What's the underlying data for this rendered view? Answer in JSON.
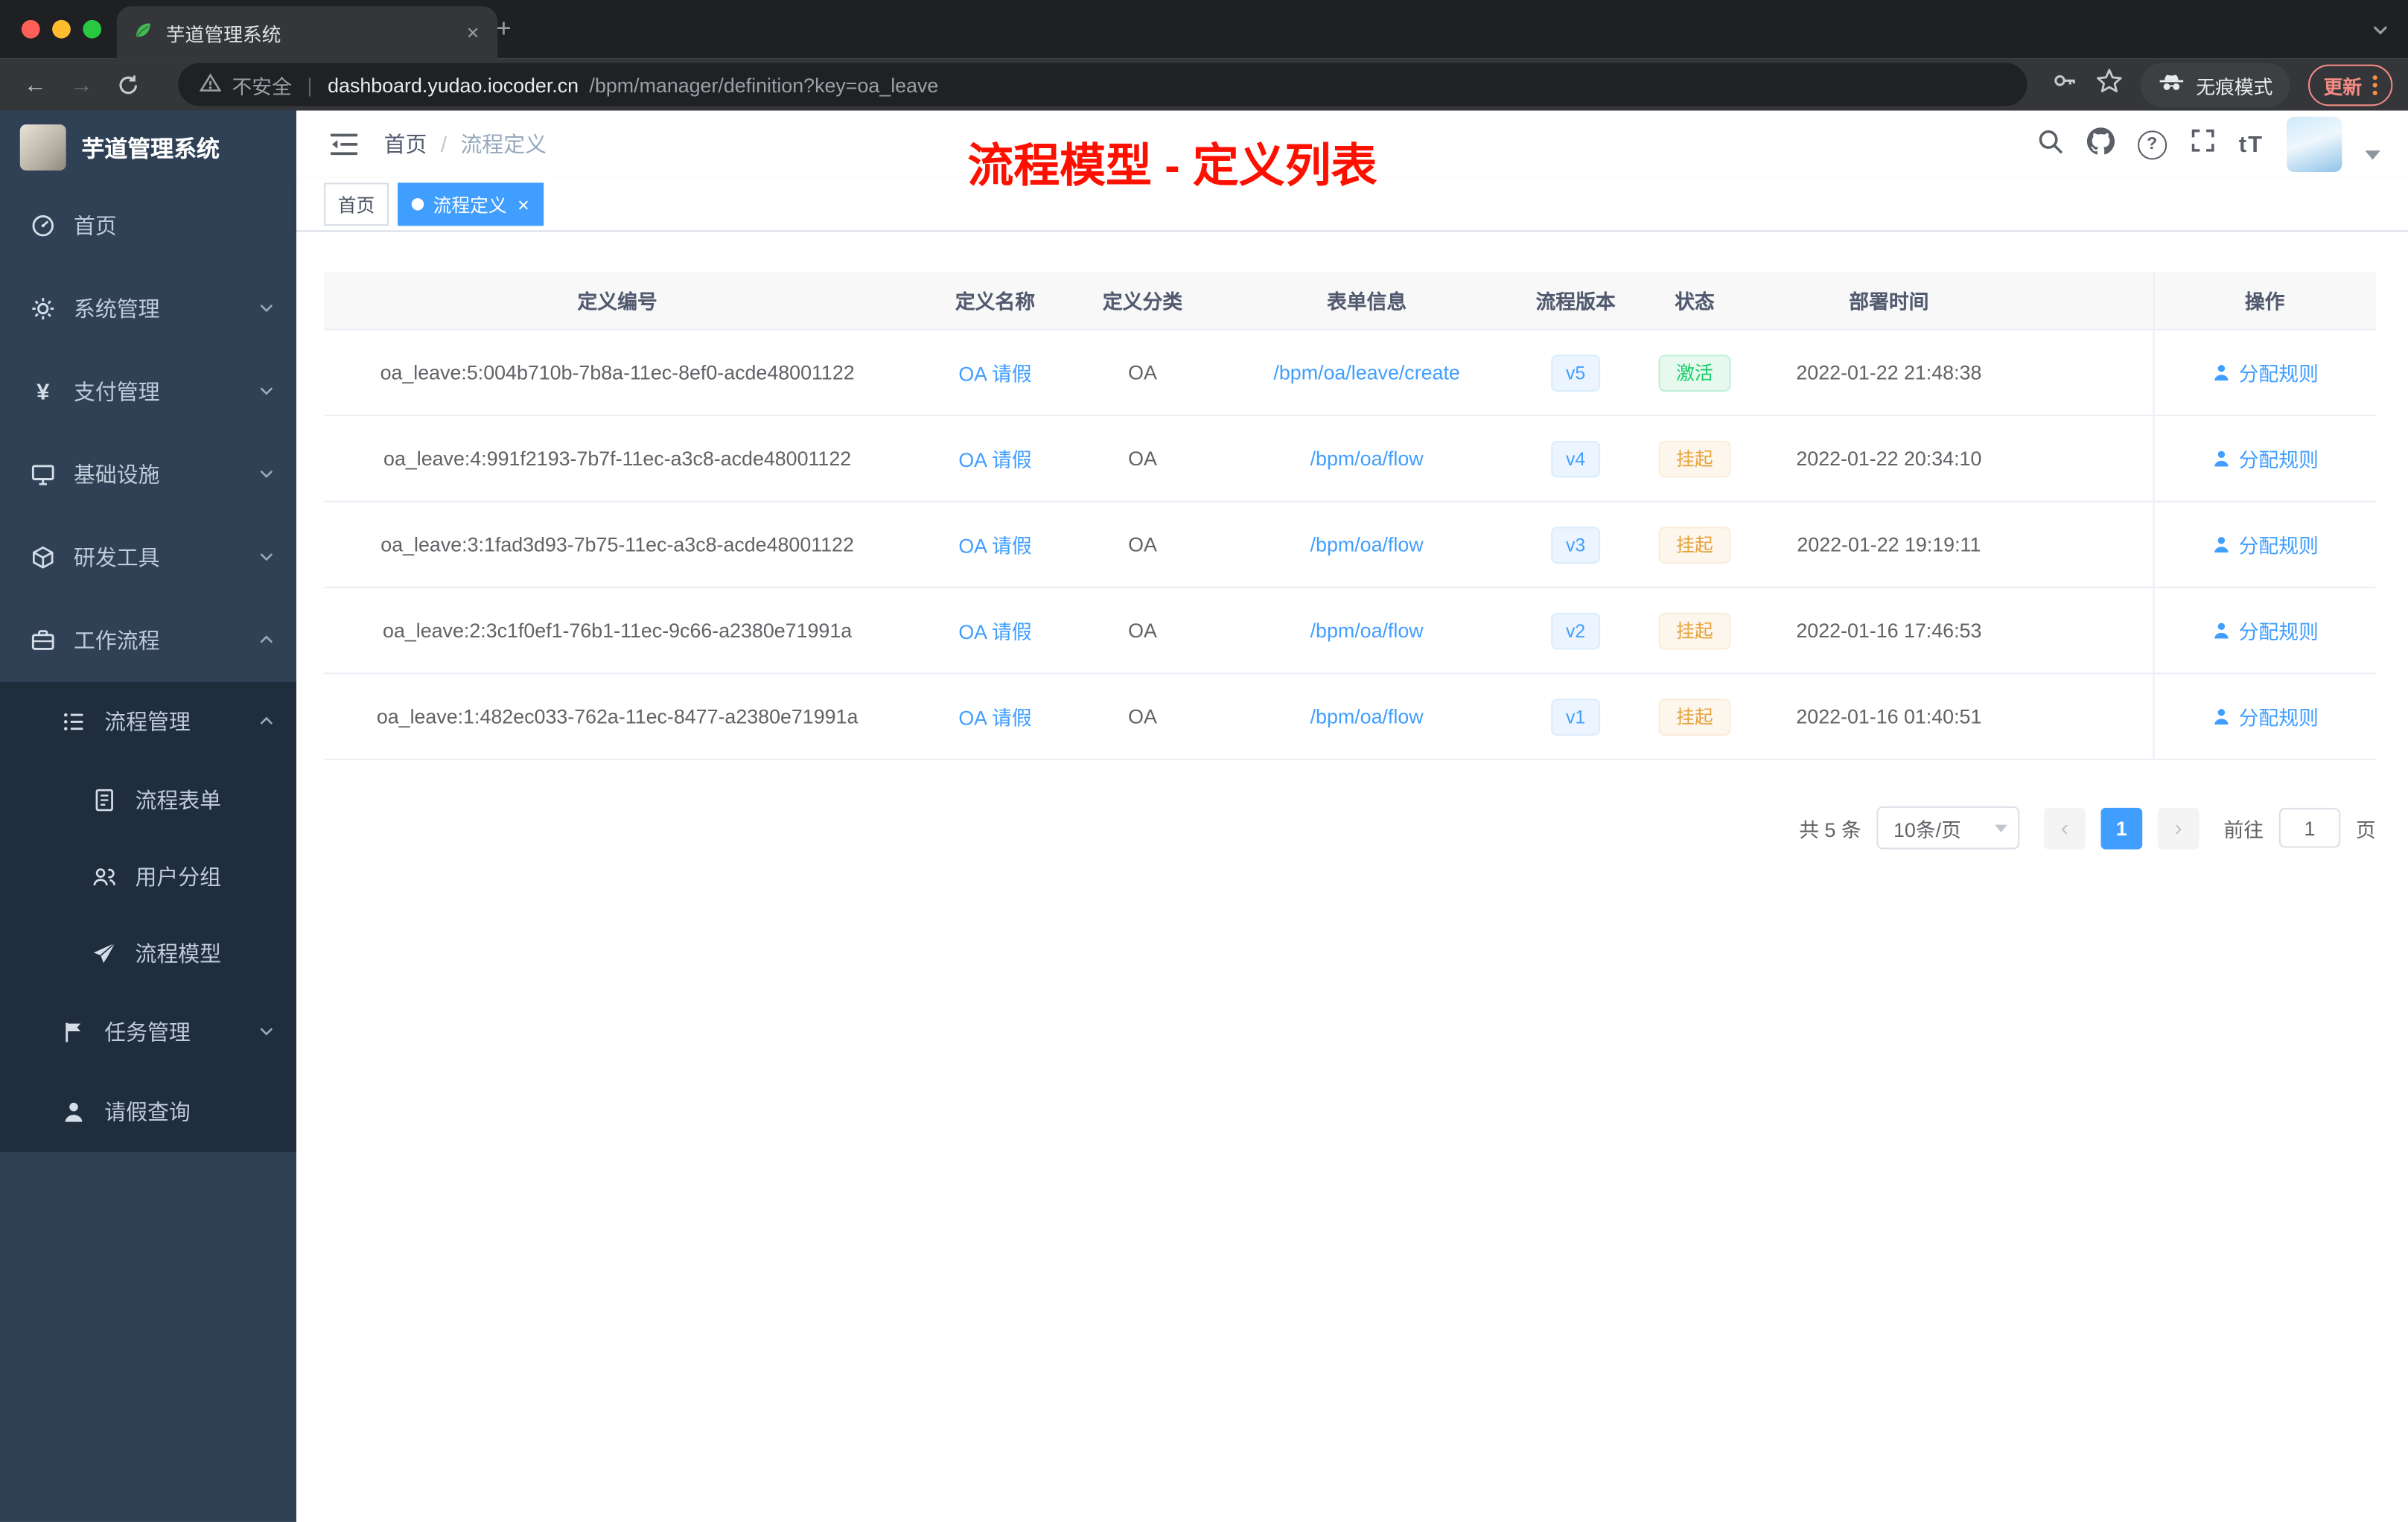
{
  "colors": {
    "accent_blue": "#409eff",
    "annotation_red": "#fe1000",
    "sidebar_bg": "#304156",
    "submenu_bg": "#1f2d3d",
    "success_green": "#13ce66",
    "warning_orange": "#e6a23c"
  },
  "icons": {
    "close": "×",
    "plus": "+",
    "back_arrow": "←",
    "forward_arrow": "→",
    "prev": "‹",
    "next": "›",
    "question": "?",
    "yen": "¥",
    "tab_caret": "⌄"
  },
  "browser": {
    "tab_title": "芋道管理系统",
    "address": {
      "security_label": "不安全",
      "separator": "|",
      "url_host": "dashboard.yudao.iocoder.cn",
      "url_path": "/bpm/manager/definition?key=oa_leave"
    },
    "incognito_label": "无痕模式",
    "update_button": "更新"
  },
  "sidebar": {
    "logo_title": "芋道管理系统",
    "items": [
      {
        "label": "首页"
      },
      {
        "label": "系统管理"
      },
      {
        "label": "支付管理"
      },
      {
        "label": "基础设施"
      },
      {
        "label": "研发工具"
      },
      {
        "label": "工作流程"
      },
      {
        "label": "流程管理"
      },
      {
        "label": "流程表单"
      },
      {
        "label": "用户分组"
      },
      {
        "label": "流程模型"
      },
      {
        "label": "任务管理"
      },
      {
        "label": "请假查询"
      }
    ]
  },
  "navbar": {
    "breadcrumb": {
      "home": "首页",
      "separator": "/",
      "current": "流程定义"
    },
    "annotation": "流程模型 - 定义列表",
    "font_icon_label": "tT"
  },
  "tags": {
    "items": [
      {
        "label": "首页",
        "active": false
      },
      {
        "label": "流程定义",
        "active": true
      }
    ]
  },
  "table": {
    "headers": [
      "定义编号",
      "定义名称",
      "定义分类",
      "表单信息",
      "流程版本",
      "状态",
      "部署时间",
      "操作"
    ],
    "rows": [
      {
        "id": "oa_leave:5:004b710b-7b8a-11ec-8ef0-acde48001122",
        "name": "OA 请假",
        "category": "OA",
        "form": "/bpm/oa/leave/create",
        "version": "v5",
        "status": "激活",
        "status_type": "success",
        "deploy_time": "2022-01-22 21:48:38",
        "action": "分配规则"
      },
      {
        "id": "oa_leave:4:991f2193-7b7f-11ec-a3c8-acde48001122",
        "name": "OA 请假",
        "category": "OA",
        "form": "/bpm/oa/flow",
        "version": "v4",
        "status": "挂起",
        "status_type": "warning",
        "deploy_time": "2022-01-22 20:34:10",
        "action": "分配规则"
      },
      {
        "id": "oa_leave:3:1fad3d93-7b75-11ec-a3c8-acde48001122",
        "name": "OA 请假",
        "category": "OA",
        "form": "/bpm/oa/flow",
        "version": "v3",
        "status": "挂起",
        "status_type": "warning",
        "deploy_time": "2022-01-22 19:19:11",
        "action": "分配规则"
      },
      {
        "id": "oa_leave:2:3c1f0ef1-76b1-11ec-9c66-a2380e71991a",
        "name": "OA 请假",
        "category": "OA",
        "form": "/bpm/oa/flow",
        "version": "v2",
        "status": "挂起",
        "status_type": "warning",
        "deploy_time": "2022-01-16 17:46:53",
        "action": "分配规则"
      },
      {
        "id": "oa_leave:1:482ec033-762a-11ec-8477-a2380e71991a",
        "name": "OA 请假",
        "category": "OA",
        "form": "/bpm/oa/flow",
        "version": "v1",
        "status": "挂起",
        "status_type": "warning",
        "deploy_time": "2022-01-16 01:40:51",
        "action": "分配规则"
      }
    ]
  },
  "pagination": {
    "total_label": "共 5 条",
    "page_size": "10条/页",
    "current_page": "1",
    "goto_label": "前往",
    "goto_value": "1",
    "page_unit": "页"
  }
}
